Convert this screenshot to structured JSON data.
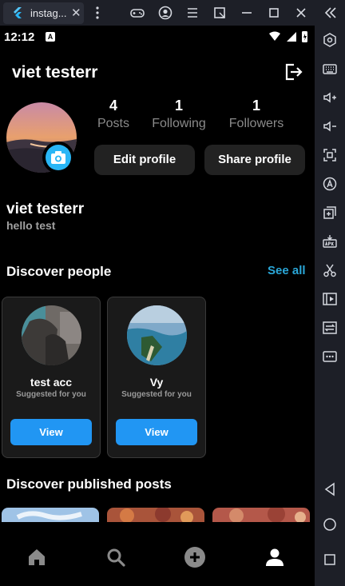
{
  "window": {
    "tab_title": "instag...",
    "tab_close": "✕"
  },
  "status_bar": {
    "time": "12:12",
    "notification_badge": "A"
  },
  "profile": {
    "username": "viet testerr",
    "display_name": "viet testerr",
    "bio": "hello test",
    "stats": [
      {
        "value": "4",
        "label": "Posts"
      },
      {
        "value": "1",
        "label": "Following"
      },
      {
        "value": "1",
        "label": "Followers"
      }
    ],
    "edit_label": "Edit profile",
    "share_label": "Share profile"
  },
  "discover": {
    "title": "Discover people",
    "see_all": "See all",
    "people": [
      {
        "name": "test acc",
        "subtitle": "Suggested for you",
        "button": "View"
      },
      {
        "name": "Vy",
        "subtitle": "Suggested for you",
        "button": "View"
      }
    ]
  },
  "posts": {
    "title": "Discover published posts"
  },
  "nav": {
    "items": [
      "home-icon",
      "search-icon",
      "add-icon",
      "profile-icon"
    ]
  },
  "colors": {
    "accent": "#2196f3",
    "link": "#2aa7d8",
    "background": "#000000",
    "emulator_chrome": "#1d1f27"
  }
}
